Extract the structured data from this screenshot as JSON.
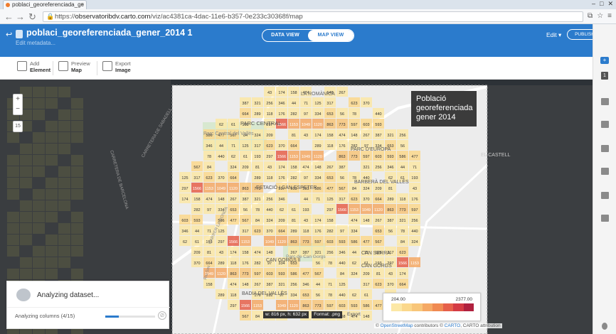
{
  "browser": {
    "tab_title": "poblaci_georeferenciada_ge",
    "url_prefix": "https://",
    "url_host": "observatoribdv.carto.com",
    "url_path": "/viz/ac4381ca-4dac-11e6-b357-0e233c30368f/map"
  },
  "header": {
    "title": "poblaci_georeferenciada_gener_2014 1",
    "edit_metadata": "Edit metadata...",
    "data_view": "DATA VIEW",
    "map_view": "MAP VIEW",
    "edit": "Edit ▾",
    "publish": "PUBLISH"
  },
  "toolbar": {
    "add_top": "Add",
    "add_bottom": "Element",
    "preview_top": "Preview",
    "preview_bottom": "Map",
    "export_top": "Export",
    "export_bottom": "Image"
  },
  "map": {
    "zoom_in": "+",
    "zoom_out": "−",
    "zoom_level": "15",
    "title": "Població georeferenciada gener 2014",
    "labels": [
      "LA ROMÀNICA",
      "PARC CENTRAL",
      "Parc Central del Vallès",
      "PARC D'EUROPA",
      "BARBERÀ DEL VALLÈS",
      "ESTACIÓ I CAN ESPETER",
      "Parc de Can Gorgs",
      "CAN GORGS II",
      "CAN SERRA",
      "CAN GORGS",
      "BADIA DEL VALLÈS",
      "EL CASTELL",
      "CARRER LA RONDA",
      "Riu Sec",
      "CARRETERA DE BARCELONA",
      "CARRETERA DE SABADELL"
    ],
    "export_dims": "w: 816 px, h: 632 px",
    "export_format": "Format: .png",
    "export_label": "Export",
    "attribution_pre": "© ",
    "attribution_osm": "OpenStreetMap",
    "attribution_mid": " contributors © ",
    "attribution_carto": "CARTO",
    "attribution_end": ", CARTO attribution"
  },
  "legend": {
    "min": "204.00",
    "max": "2377.00",
    "colors": [
      "#fce8a6",
      "#fbd88c",
      "#f8c67a",
      "#f5a965",
      "#f08a52",
      "#e6604a",
      "#d43b44",
      "#b0213f"
    ]
  },
  "analyze": {
    "title": "Analyzing dataset...",
    "columns": "Analyzing columns (4/15)",
    "progress": 0.27
  },
  "grid_values": {
    "cells": [
      [
        "43",
        "174",
        "158",
        "474",
        "148",
        "267",
        "387",
        "321",
        "256",
        "LA ROMÀNICA",
        "",
        "",
        ""
      ],
      [
        "",
        "71",
        "125",
        "317",
        "",
        "623",
        "370",
        "664",
        "289",
        "346",
        "44",
        "",
        ""
      ],
      [
        "",
        "",
        "",
        "",
        "",
        "",
        "",
        "",
        "",
        "",
        "",
        "",
        ""
      ],
      [
        "",
        "",
        "",
        "",
        "",
        "",
        "440",
        "62",
        "",
        "193",
        "",
        "297",
        ""
      ]
    ]
  },
  "numbers": [
    {
      "v": "43",
      "a": "t"
    },
    {
      "v": "174",
      "a": "t"
    },
    {
      "v": "158",
      "a": "t"
    },
    {
      "v": "474",
      "a": "t"
    },
    {
      "v": "148",
      "a": "t"
    },
    {
      "v": "267",
      "a": "t"
    },
    {
      "v": "387",
      "a": "t"
    },
    {
      "v": "321",
      "a": "t"
    },
    {
      "v": "256",
      "a": "t"
    },
    {
      "v": "346",
      "a": "t"
    },
    {
      "v": "44",
      "a": "t"
    },
    {
      "v": "71",
      "a": "t"
    },
    {
      "v": "125",
      "a": "t"
    },
    {
      "v": "317",
      "a": "t"
    },
    {
      "v": "623",
      "a": "t"
    },
    {
      "v": "370",
      "a": "t"
    },
    {
      "v": "664",
      "a": "t"
    },
    {
      "v": "289",
      "a": "t"
    },
    {
      "v": "118",
      "a": "t"
    },
    {
      "v": "176",
      "a": "t"
    },
    {
      "v": "282",
      "a": "t"
    },
    {
      "v": "97",
      "a": "t"
    },
    {
      "v": "334",
      "a": "t"
    },
    {
      "v": "653",
      "a": "t"
    },
    {
      "v": "56",
      "a": "t"
    },
    {
      "v": "78",
      "a": "t"
    },
    {
      "v": "440",
      "a": "t"
    },
    {
      "v": "62",
      "a": "t"
    },
    {
      "v": "61",
      "a": "t"
    },
    {
      "v": "193",
      "a": "t"
    },
    {
      "v": "297",
      "a": "t"
    },
    {
      "v": "1566",
      "a": "t"
    },
    {
      "v": "1153",
      "a": "t"
    },
    {
      "v": "1049",
      "a": "t"
    },
    {
      "v": "1120",
      "a": "t"
    },
    {
      "v": "863",
      "a": "t"
    },
    {
      "v": "773",
      "a": "t"
    },
    {
      "v": "597",
      "a": "t"
    },
    {
      "v": "603",
      "a": "t"
    },
    {
      "v": "593",
      "a": "t"
    },
    {
      "v": "586",
      "a": "t"
    },
    {
      "v": "477",
      "a": "t"
    },
    {
      "v": "567",
      "a": "t"
    },
    {
      "v": "84",
      "a": "t"
    },
    {
      "v": "324",
      "a": "t"
    },
    {
      "v": "209",
      "a": "t"
    },
    {
      "v": "81",
      "a": "t"
    }
  ]
}
